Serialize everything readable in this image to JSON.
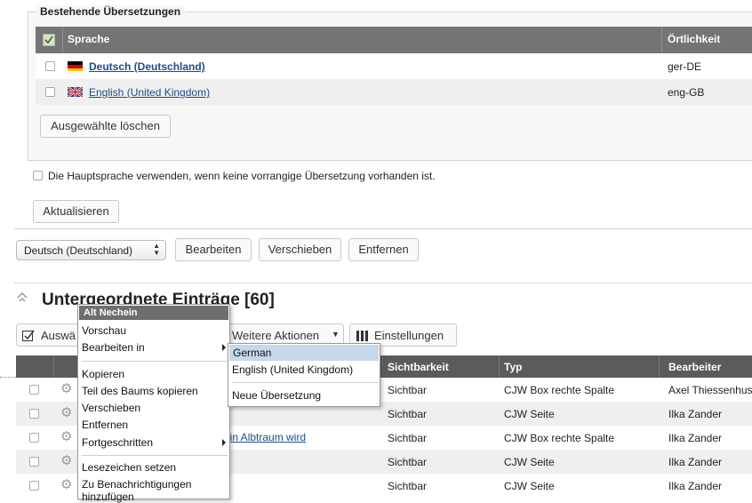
{
  "translations": {
    "legend": "Bestehende Übersetzungen",
    "columns": {
      "language": "Sprache",
      "locale": "Örtlichkeit"
    },
    "rows": [
      {
        "language": "Deutsch (Deutschland)",
        "locale": "ger-DE",
        "flag": "de-flag-icon"
      },
      {
        "language": "English (United Kingdom)",
        "locale": "eng-GB",
        "flag": "gb-flag-icon"
      }
    ],
    "delete_selected": "Ausgewählte löschen",
    "main_language_label": "Die Hauptsprache verwenden, wenn keine vorrangige Übersetzung vorhanden ist.",
    "update_button": "Aktualisieren"
  },
  "language_bar": {
    "selected_language": "Deutsch (Deutschland)",
    "edit_button": "Bearbeiten",
    "move_button": "Verschieben",
    "remove_button": "Entfernen"
  },
  "subitems": {
    "title": "Untergeordnete Einträge [60]",
    "select_button": "Auswä",
    "more_actions": "Weitere Aktionen",
    "settings": "Einstellungen",
    "columns": {
      "visibility": "Sichtbarkeit",
      "type": "Typ",
      "editor": "Bearbeiter"
    },
    "rows": [
      {
        "name": "",
        "visibility": "Sichtbar",
        "type": "CJW Box rechte Spalte",
        "editor": "Axel Thiessenhus"
      },
      {
        "name": "",
        "visibility": "Sichtbar",
        "type": "CJW Seite",
        "editor": "Ilka Zander"
      },
      {
        "name": "ein Albtraum wird",
        "visibility": "Sichtbar",
        "type": "CJW Box rechte Spalte",
        "editor": "Ilka Zander"
      },
      {
        "name": "",
        "visibility": "Sichtbar",
        "type": "CJW Seite",
        "editor": "Ilka Zander"
      },
      {
        "name": "",
        "visibility": "Sichtbar",
        "type": "CJW Seite",
        "editor": "Ilka Zander"
      }
    ]
  },
  "context_menu": {
    "header": "Alt Nechein",
    "items": {
      "preview": "Vorschau",
      "edit_in": "Bearbeiten in",
      "copy": "Kopieren",
      "copy_subtree": "Teil des Baums kopieren",
      "move": "Verschieben",
      "remove": "Entfernen",
      "advanced": "Fortgeschritten",
      "bookmark": "Lesezeichen setzen",
      "notify_line1": "Zu Benachrichtigungen",
      "notify_line2": "hinzufügen"
    }
  },
  "submenu": {
    "items": {
      "german": "German",
      "english": "English (United Kingdom)",
      "new_translation": "Neue Übersetzung"
    }
  }
}
